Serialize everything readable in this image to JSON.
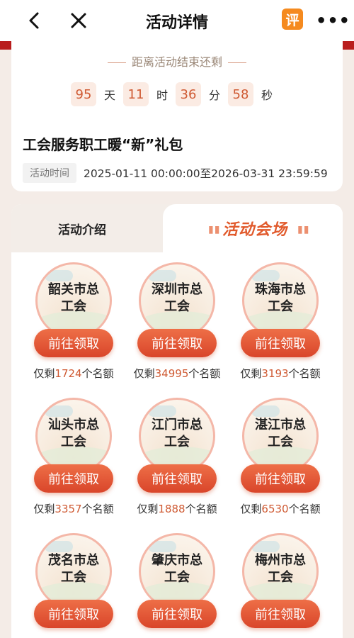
{
  "nav": {
    "title": "活动详情",
    "review_badge": "评",
    "more": "•••",
    "icons": {
      "back": "chevron-left-icon",
      "close": "close-icon",
      "review": "review-icon",
      "more": "more-icon"
    }
  },
  "countdown": {
    "label": "距离活动结束还剩",
    "days": "95",
    "days_unit": "天",
    "hours": "11",
    "hours_unit": "时",
    "minutes": "36",
    "minutes_unit": "分",
    "seconds": "58",
    "seconds_unit": "秒"
  },
  "activity": {
    "title": "工会服务职工暖“新”礼包",
    "time_label": "活动时间",
    "time_value": "2025-01-11 00:00:00至2026-03-31 23:59:59"
  },
  "tabs": {
    "intro": "活动介绍",
    "venue": "活动会场"
  },
  "colors": {
    "accent": "#e15a2c",
    "brand_red": "#b91d1d",
    "count_bg": "#fbebe3"
  },
  "venues": [
    {
      "name1": "韶关市总",
      "name2": "工会",
      "button": "前往领取",
      "prefix": "仅剩",
      "count": "1724",
      "suffix": "个名额"
    },
    {
      "name1": "深圳市总",
      "name2": "工会",
      "button": "前往领取",
      "prefix": "仅剩",
      "count": "34995",
      "suffix": "个名额"
    },
    {
      "name1": "珠海市总",
      "name2": "工会",
      "button": "前往领取",
      "prefix": "仅剩",
      "count": "3193",
      "suffix": "个名额"
    },
    {
      "name1": "汕头市总",
      "name2": "工会",
      "button": "前往领取",
      "prefix": "仅剩",
      "count": "3357",
      "suffix": "个名额"
    },
    {
      "name1": "江门市总",
      "name2": "工会",
      "button": "前往领取",
      "prefix": "仅剩",
      "count": "1888",
      "suffix": "个名额"
    },
    {
      "name1": "湛江市总",
      "name2": "工会",
      "button": "前往领取",
      "prefix": "仅剩",
      "count": "6530",
      "suffix": "个名额"
    },
    {
      "name1": "茂名市总",
      "name2": "工会",
      "button": "前往领取"
    },
    {
      "name1": "肇庆市总",
      "name2": "工会",
      "button": "前往领取"
    },
    {
      "name1": "梅州市总",
      "name2": "工会",
      "button": "前往领取"
    }
  ]
}
